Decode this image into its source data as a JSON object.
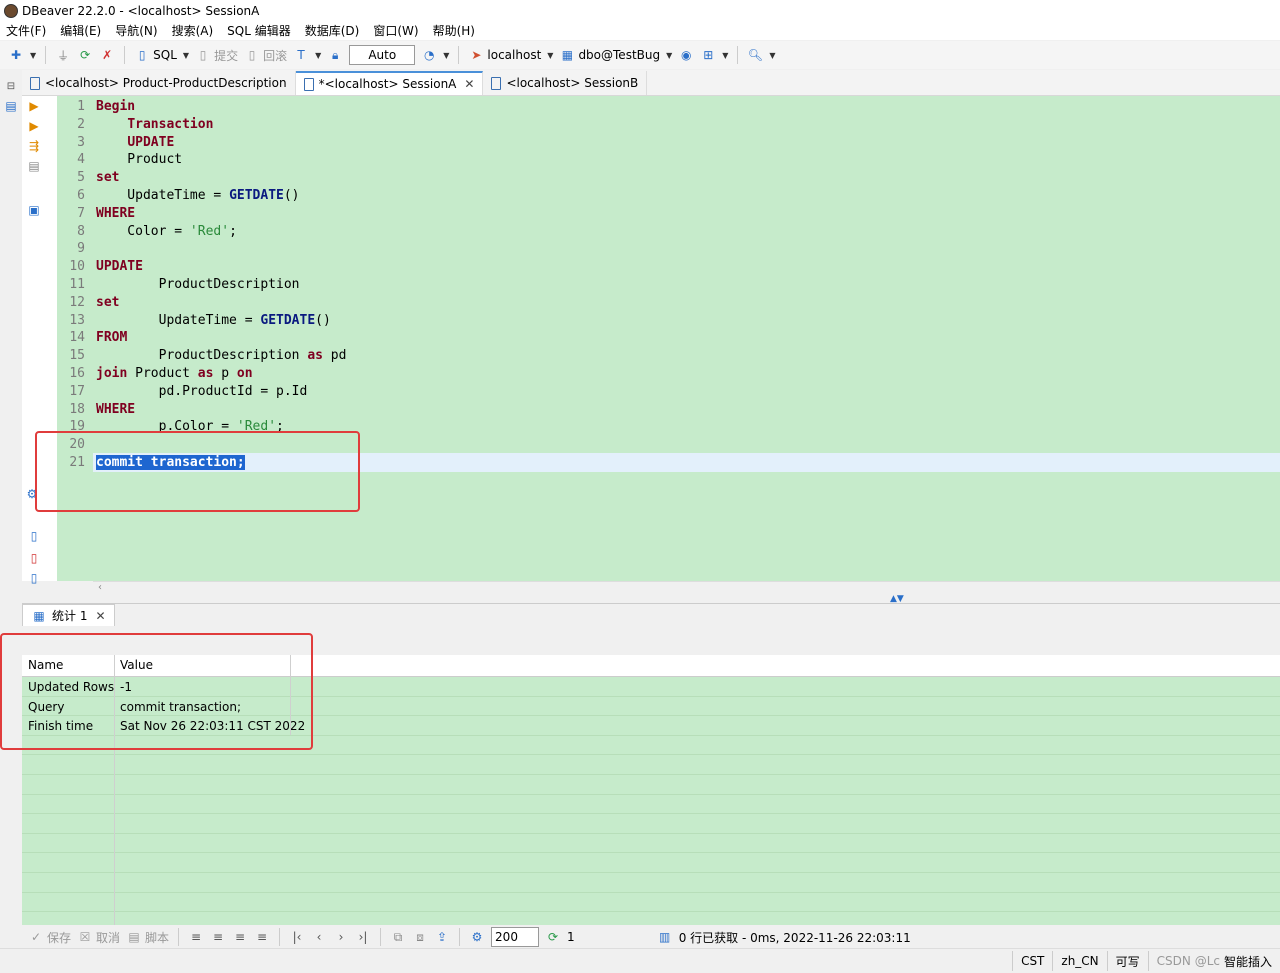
{
  "window": {
    "title": "DBeaver 22.2.0 - <localhost> SessionA"
  },
  "menu": [
    "文件(F)",
    "编辑(E)",
    "导航(N)",
    "搜索(A)",
    "SQL 编辑器",
    "数据库(D)",
    "窗口(W)",
    "帮助(H)"
  ],
  "toolbar": {
    "sql_label": "SQL",
    "commit_label": "提交",
    "rollback_label": "回滚",
    "auto_label": "Auto",
    "connection_label": "localhost",
    "schema_label": "dbo@TestBug"
  },
  "tabs": [
    {
      "label": "<localhost> Product-ProductDescription",
      "active": false
    },
    {
      "label": "*<localhost> SessionA",
      "active": true
    },
    {
      "label": "<localhost> SessionB",
      "active": false
    }
  ],
  "editor": {
    "line_numbers": [
      "1",
      "2",
      "3",
      "4",
      "5",
      "6",
      "7",
      "8",
      "9",
      "10",
      "11",
      "12",
      "13",
      "14",
      "15",
      "16",
      "17",
      "18",
      "19",
      "20",
      "21"
    ],
    "lines": [
      [
        {
          "t": "Begin",
          "c": "kw"
        }
      ],
      [
        {
          "t": "    "
        },
        {
          "t": "Transaction",
          "c": "kw"
        }
      ],
      [
        {
          "t": "    "
        },
        {
          "t": "UPDATE",
          "c": "kw"
        }
      ],
      [
        {
          "t": "    Product"
        }
      ],
      [
        {
          "t": "set",
          "c": "kw"
        }
      ],
      [
        {
          "t": "    UpdateTime = "
        },
        {
          "t": "GETDATE",
          "c": "fn"
        },
        {
          "t": "()"
        }
      ],
      [
        {
          "t": "WHERE",
          "c": "kw"
        }
      ],
      [
        {
          "t": "    Color = "
        },
        {
          "t": "'Red'",
          "c": "str"
        },
        {
          "t": ";"
        }
      ],
      [],
      [
        {
          "t": "UPDATE",
          "c": "kw"
        }
      ],
      [
        {
          "t": "        ProductDescription"
        }
      ],
      [
        {
          "t": "set",
          "c": "kw"
        }
      ],
      [
        {
          "t": "        UpdateTime = "
        },
        {
          "t": "GETDATE",
          "c": "fn"
        },
        {
          "t": "()"
        }
      ],
      [
        {
          "t": "FROM",
          "c": "kw"
        }
      ],
      [
        {
          "t": "        ProductDescription "
        },
        {
          "t": "as",
          "c": "kw"
        },
        {
          "t": " pd"
        }
      ],
      [
        {
          "t": "join",
          "c": "kw"
        },
        {
          "t": " Product "
        },
        {
          "t": "as",
          "c": "kw"
        },
        {
          "t": " p "
        },
        {
          "t": "on",
          "c": "kw"
        }
      ],
      [
        {
          "t": "        pd.ProductId = p.Id"
        }
      ],
      [
        {
          "t": "WHERE",
          "c": "kw"
        }
      ],
      [
        {
          "t": "        p.Color = "
        },
        {
          "t": "'Red'",
          "c": "str"
        },
        {
          "t": ";"
        }
      ],
      [],
      [
        {
          "t": "commit transaction;",
          "c": "kw sel"
        }
      ]
    ]
  },
  "results": {
    "tab_label": "统计 1",
    "headers": [
      "Name",
      "Value"
    ],
    "rows": [
      [
        "Updated Rows",
        "-1"
      ],
      [
        "Query",
        "commit transaction;"
      ],
      [
        "Finish time",
        "Sat Nov 26 22:03:11 CST 2022"
      ]
    ]
  },
  "resultbar": {
    "save_label": "保存",
    "cancel_label": "取消",
    "script_label": "脚本",
    "fetch_size": "200",
    "refresh_count": "1",
    "fetch_status": "0 行已获取 - 0ms, 2022-11-26 22:03:11"
  },
  "statusbar": {
    "timezone": "CST",
    "locale": "zh_CN",
    "mode": "可写",
    "insert_mode": "智能插入",
    "watermark": "CSDN @Lc"
  }
}
